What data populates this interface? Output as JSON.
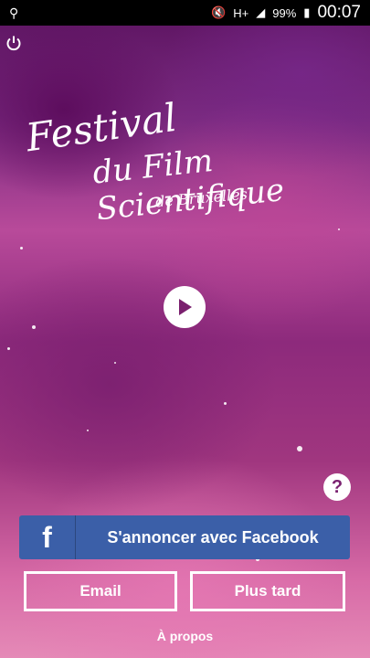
{
  "status_bar": {
    "network_label": "H+",
    "battery": "99%",
    "time": "00:07"
  },
  "logo": {
    "line1": "Festival",
    "line2": "du Film Scientifique",
    "line3": "de Bruxelles"
  },
  "buttons": {
    "facebook_icon": "f",
    "facebook_label": "S'annoncer avec Facebook",
    "email_label": "Email",
    "later_label": "Plus tard",
    "about_label": "À propos",
    "help_label": "?"
  },
  "colors": {
    "facebook_blue": "#3b5fa8",
    "white": "#ffffff"
  },
  "icons": {
    "power": "power-icon",
    "play": "play-icon",
    "help": "question-icon",
    "usb": "usb-icon",
    "signal": "signal-icon",
    "battery": "battery-charging-icon",
    "mute": "mute-icon"
  }
}
